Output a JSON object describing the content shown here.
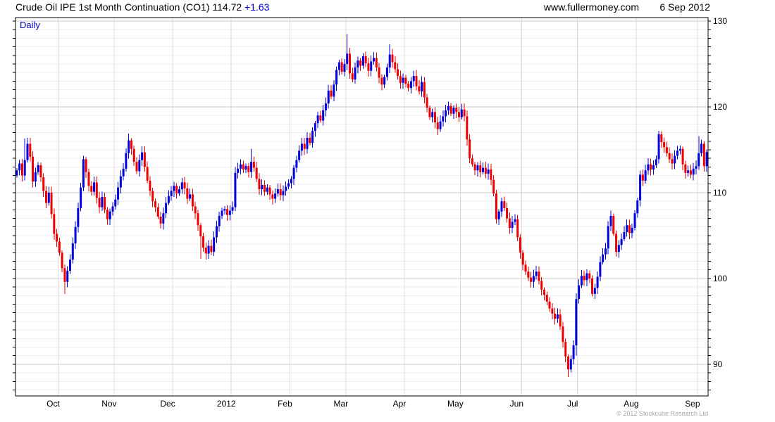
{
  "header": {
    "title": "Crude Oil IPE 1st Month Continuation (CO1)",
    "last_price": "114.72",
    "change": "+1.63",
    "website": "www.fullermoney.com",
    "date": "6 Sep 2012"
  },
  "chart": {
    "timeframe_label": "Daily",
    "copyright": "© 2012 Stockcube Research Ltd"
  },
  "colors": {
    "up": "#0000dd",
    "down": "#ee0000",
    "accent_blue": "#0000cc",
    "grid_major": "#c9c9c9",
    "grid_minor": "#efefef",
    "grid_month": "#dcdcdc",
    "axis": "#000000",
    "copyright_gray": "#a6a6a6"
  },
  "chart_data": {
    "type": "candlestick",
    "title": "Crude Oil IPE 1st Month Continuation (CO1)",
    "timeframe": "Daily",
    "last": 114.72,
    "change": 1.63,
    "ylim": [
      86.3,
      130.41
    ],
    "y_major_ticks": [
      90,
      100,
      110,
      120,
      130
    ],
    "y_minor_step": 1,
    "grid": true,
    "x_axis": {
      "total_days": 260,
      "months": [
        {
          "label": "Oct",
          "day": 16
        },
        {
          "label": "Nov",
          "day": 37
        },
        {
          "label": "Dec",
          "day": 59
        },
        {
          "label": "2012",
          "day": 81
        },
        {
          "label": "Feb",
          "day": 103
        },
        {
          "label": "Mar",
          "day": 124
        },
        {
          "label": "Apr",
          "day": 146
        },
        {
          "label": "May",
          "day": 167
        },
        {
          "label": "Jun",
          "day": 190
        },
        {
          "label": "Jul",
          "day": 211
        },
        {
          "label": "Aug",
          "day": 233
        },
        {
          "label": "Sep",
          "day": 256
        }
      ]
    },
    "closes": [
      112.6,
      113.4,
      112.0,
      113.8,
      115.7,
      114.2,
      111.3,
      112.4,
      113.2,
      111.8,
      110.2,
      108.8,
      110.0,
      107.5,
      105.2,
      104.3,
      103.0,
      101.2,
      99.6,
      100.9,
      102.2,
      104.1,
      106.0,
      108.2,
      110.6,
      113.9,
      112.4,
      110.8,
      110.1,
      111.2,
      109.4,
      108.3,
      109.5,
      108.0,
      106.9,
      107.8,
      108.4,
      109.2,
      110.6,
      111.9,
      112.8,
      114.6,
      116.1,
      115.1,
      113.6,
      112.5,
      113.8,
      114.7,
      113.0,
      111.4,
      110.2,
      109.0,
      108.3,
      107.2,
      106.4,
      107.6,
      108.8,
      109.6,
      110.2,
      110.8,
      109.9,
      110.4,
      111.2,
      110.5,
      109.3,
      109.8,
      108.4,
      107.6,
      106.2,
      104.9,
      103.6,
      102.9,
      103.8,
      103.1,
      104.8,
      106.1,
      107.3,
      107.9,
      108.1,
      107.4,
      107.9,
      108.3,
      112.3,
      112.8,
      113.3,
      112.7,
      113.1,
      112.4,
      113.6,
      112.9,
      111.6,
      110.4,
      110.9,
      110.1,
      110.6,
      109.8,
      109.3,
      109.9,
      110.4,
      109.7,
      110.2,
      110.7,
      111.1,
      111.6,
      112.9,
      113.8,
      114.9,
      115.7,
      115.1,
      116.4,
      115.8,
      117.2,
      118.1,
      119.0,
      118.4,
      119.6,
      120.4,
      121.9,
      121.2,
      122.6,
      124.3,
      125.2,
      124.1,
      125.0,
      126.2,
      123.9,
      123.2,
      124.6,
      125.4,
      124.8,
      125.9,
      125.1,
      124.2,
      125.3,
      125.7,
      124.6,
      123.4,
      122.6,
      123.5,
      124.6,
      126.1,
      125.2,
      124.4,
      123.6,
      122.8,
      123.4,
      122.7,
      122.2,
      123.0,
      123.6,
      122.4,
      121.8,
      122.9,
      121.1,
      119.9,
      118.8,
      119.4,
      118.2,
      117.4,
      118.3,
      118.9,
      119.6,
      120.1,
      119.2,
      119.9,
      119.4,
      118.8,
      119.7,
      118.9,
      116.2,
      114.0,
      113.3,
      112.6,
      113.2,
      112.4,
      112.9,
      112.2,
      112.7,
      111.5,
      109.9,
      106.9,
      107.8,
      109.0,
      108.2,
      107.0,
      105.9,
      106.6,
      106.9,
      104.8,
      103.0,
      101.6,
      100.8,
      100.1,
      99.6,
      100.3,
      100.8,
      99.7,
      98.7,
      98.1,
      97.3,
      96.5,
      95.9,
      95.3,
      95.8,
      94.4,
      92.6,
      90.9,
      89.4,
      90.6,
      92.2,
      97.6,
      99.2,
      100.3,
      99.8,
      100.6,
      100.0,
      98.2,
      98.9,
      100.2,
      101.9,
      102.8,
      103.5,
      106.1,
      107.3,
      105.2,
      103.1,
      103.9,
      104.6,
      105.4,
      106.2,
      105.3,
      105.9,
      107.6,
      109.1,
      112.1,
      111.4,
      112.6,
      113.3,
      112.7,
      113.2,
      113.9,
      116.8,
      115.9,
      115.3,
      114.6,
      113.9,
      113.4,
      114.3,
      114.9,
      115.1,
      113.3,
      112.3,
      112.6,
      112.1,
      112.8,
      113.09,
      114.6,
      115.7,
      113.09,
      114.72
    ],
    "wick_overrides": {
      "3": {
        "h": 116.3
      },
      "18": {
        "l": 98.2
      },
      "42": {
        "h": 116.9
      },
      "69": {
        "l": 102.3
      },
      "88": {
        "h": 115.1
      },
      "124": {
        "h": 128.5
      },
      "140": {
        "h": 127.3
      },
      "158": {
        "l": 116.7
      },
      "207": {
        "l": 88.5
      },
      "210": {
        "l": 91.0
      },
      "223": {
        "h": 107.9
      },
      "241": {
        "h": 117.2
      },
      "256": {
        "h": 116.6
      }
    }
  }
}
